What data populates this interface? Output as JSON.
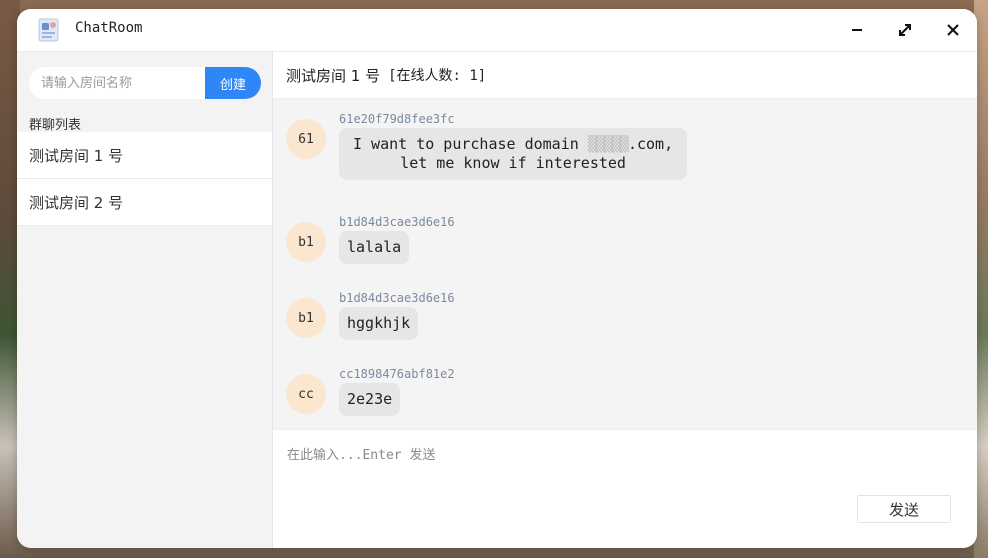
{
  "app": {
    "title": "ChatRoom"
  },
  "sidebar": {
    "search_placeholder": "请输入房间名称",
    "create_label": "创建",
    "list_title": "群聊列表",
    "rooms": [
      {
        "label": "测试房间 1 号"
      },
      {
        "label": "测试房间 2 号"
      }
    ]
  },
  "room": {
    "title": "测试房间 1 号",
    "online_label": "[在线人数: 1]"
  },
  "messages": [
    {
      "avatar": "61",
      "sender": "61e20f79d8fee3fc",
      "text_line1": "I want to purchase domain ",
      "text_blur": "▒▒▒▒▒",
      "text_line1_end": ".com,",
      "text_line2": "let me know if interested"
    },
    {
      "avatar": "b1",
      "sender": "b1d84d3cae3d6e16",
      "text": "lalala"
    },
    {
      "avatar": "b1",
      "sender": "b1d84d3cae3d6e16",
      "text": "hggkhjk"
    },
    {
      "avatar": "cc",
      "sender": "cc1898476abf81e2",
      "text": "2e23e"
    }
  ],
  "composer": {
    "placeholder": "在此输入...Enter 发送",
    "send_label": "发送"
  },
  "colors": {
    "accent": "#2f86f6",
    "avatar_bg": "#fbe6cf",
    "bubble_bg": "#e6e6e6"
  },
  "icons": [
    "app-icon",
    "minimize-icon",
    "maximize-icon",
    "close-icon"
  ]
}
